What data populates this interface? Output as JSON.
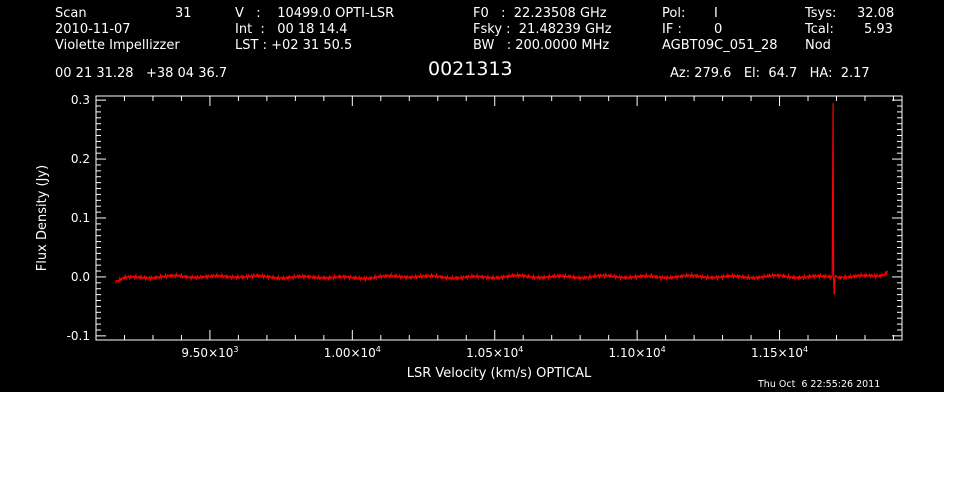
{
  "header": {
    "scan_label": "Scan",
    "scan_value": "31",
    "date": "2010-11-07",
    "observer": "Violette Impellizzer",
    "coords": "00 21 31.28   +38 04 36.7",
    "v": "V   :    10499.0 OPTI-LSR",
    "int": "Int  :   00 18 14.4",
    "lst": "LST : +02 31 50.5",
    "f0": "F0   :  22.23508 GHz",
    "fsky": "Fsky :  21.48239 GHz",
    "bw": "BW   : 200.0000 MHz",
    "pol_label": "Pol:",
    "pol_value": "I",
    "if_label": "IF :",
    "if_value": "0",
    "project": "AGBT09C_051_28",
    "tsys_label": "Tsys:",
    "tsys_value": "32.08",
    "tcal_label": "Tcal:",
    "tcal_value": "5.93",
    "proc": "Nod",
    "az": "Az: 279.6   El:  64.7   HA:  2.17"
  },
  "object_name": "0021313",
  "timestamp": "Thu Oct  6 22:55:26 2011",
  "chart_data": {
    "type": "line",
    "xlabel": "LSR Velocity (km/s) OPTICAL",
    "ylabel": "Flux Density (Jy)",
    "xlim": [
      9100,
      11930
    ],
    "ylim": [
      -0.107,
      0.307
    ],
    "x_ticks": [
      9500,
      10000,
      10500,
      11000,
      11500
    ],
    "x_tick_labels": [
      {
        "mant": "9.50×10",
        "exp": "3"
      },
      {
        "mant": "1.00×10",
        "exp": "4"
      },
      {
        "mant": "1.05×10",
        "exp": "4"
      },
      {
        "mant": "1.10×10",
        "exp": "4"
      },
      {
        "mant": "1.15×10",
        "exp": "4"
      }
    ],
    "y_ticks": [
      -0.1,
      0.0,
      0.1,
      0.2,
      0.3
    ],
    "y_tick_labels": [
      "-0.1",
      "0.0",
      "0.1",
      "0.2",
      "0.3"
    ],
    "series": [
      {
        "color": "#ff0000",
        "x": [
          9168,
          9200,
          9300,
          9400,
          9500,
          9600,
          9700,
          9800,
          9900,
          10000,
          10100,
          10200,
          10300,
          10400,
          10500,
          10600,
          10700,
          10800,
          10900,
          11000,
          11100,
          11200,
          11300,
          11400,
          11500,
          11600,
          11680,
          11685,
          11688,
          11690,
          11692,
          11695,
          11700,
          11750,
          11800,
          11850,
          11870,
          11880
        ],
        "y": [
          -0.008,
          -0.002,
          0.0,
          0.001,
          0.0,
          0.001,
          0.0,
          -0.001,
          0.0,
          -0.002,
          0.0,
          0.001,
          0.0,
          -0.001,
          0.0,
          0.001,
          0.0,
          0.0,
          0.001,
          0.0,
          0.0,
          0.001,
          0.0,
          0.0,
          0.001,
          0.0,
          0.0,
          0.003,
          0.295,
          0.0,
          -0.03,
          0.0,
          0.001,
          0.0,
          0.001,
          0.003,
          0.006,
          0.01
        ]
      }
    ]
  }
}
